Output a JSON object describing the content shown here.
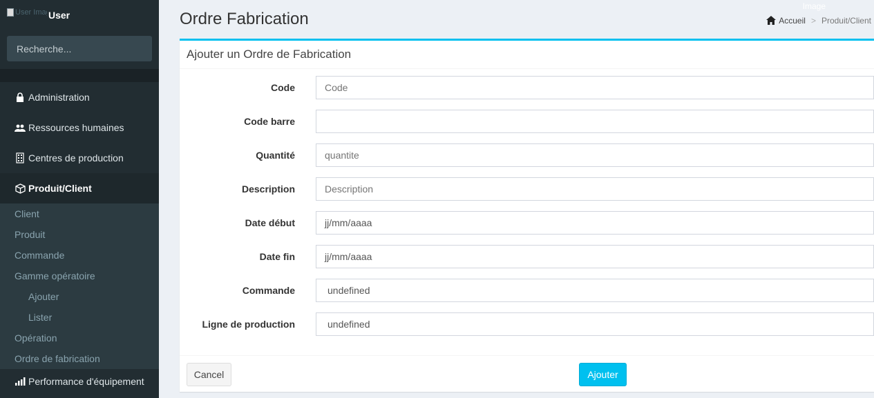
{
  "sidebar": {
    "user_image_alt": "User Image",
    "user_name": "User",
    "search_placeholder": "Recherche...",
    "menu": [
      {
        "label": "Administration",
        "icon": "lock-icon"
      },
      {
        "label": "Ressources humaines",
        "icon": "users-icon"
      },
      {
        "label": "Centres de production",
        "icon": "building-icon"
      },
      {
        "label": "Produit/Client",
        "icon": "cube-icon"
      },
      {
        "label": "Performance d'équipement",
        "icon": "bar-chart-icon"
      }
    ],
    "submenu": [
      "Client",
      "Produit",
      "Commande",
      "Gamme opératoire",
      "Ajouter",
      "Lister",
      "Opération",
      "Ordre de fabrication"
    ]
  },
  "header": {
    "title": "Ordre Fabrication",
    "image_alt": "Image",
    "breadcrumb": {
      "home": "Accueil",
      "separator": ">",
      "current": "Produit/Client"
    }
  },
  "form": {
    "title": "Ajouter un Ordre de Fabrication",
    "fields": [
      {
        "label": "Code",
        "value": "",
        "placeholder": "Code"
      },
      {
        "label": "Code barre",
        "value": "",
        "placeholder": ""
      },
      {
        "label": "Quantité",
        "value": "",
        "placeholder": "quantite"
      },
      {
        "label": "Description",
        "value": "",
        "placeholder": "Description"
      },
      {
        "label": "Date début",
        "value": "jj/mm/aaaa",
        "placeholder": ""
      },
      {
        "label": "Date fin",
        "value": "jj/mm/aaaa",
        "placeholder": ""
      },
      {
        "label": "Commande",
        "value": "undefined",
        "placeholder": ""
      },
      {
        "label": "Ligne de production",
        "value": "undefined",
        "placeholder": ""
      }
    ],
    "cancel_label": "Cancel",
    "submit_label": "Ajouter"
  },
  "colors": {
    "sidebar_bg": "#222d32",
    "accent": "#00c0ef",
    "content_bg": "#ecf0f5"
  }
}
